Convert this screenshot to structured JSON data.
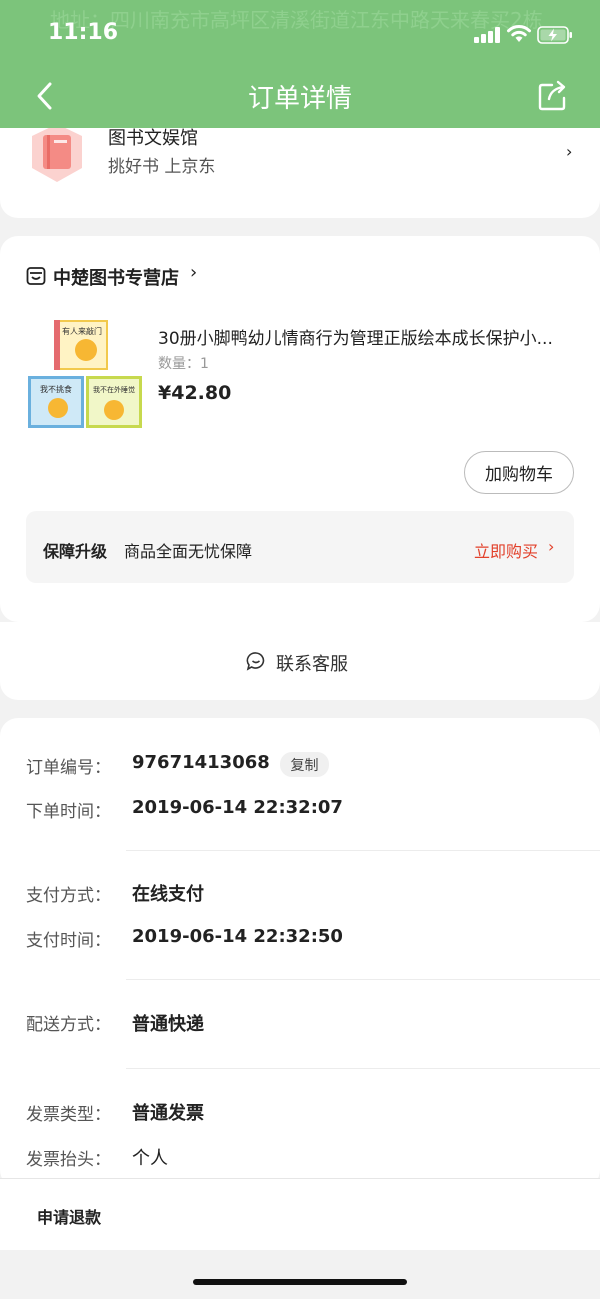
{
  "status_bar": {
    "time": "11:16",
    "ghost_text": "地址：四川南充市高坪区清溪街道江东中路天来春买2栋"
  },
  "header": {
    "title": "订单详情",
    "back_icon": "chevron-left-icon",
    "share_icon": "share-icon",
    "background": "#7cc47b"
  },
  "brand": {
    "name": "图书文娱馆",
    "slogan": "挑好书 上京东",
    "chevron": "›"
  },
  "store": {
    "name": "中楚图书专营店",
    "arrow": "›"
  },
  "product": {
    "title": "30册小脚鸭幼儿情商行为管理正版绘本成长保护小...",
    "quantity": "数量：1",
    "price": "¥42.80",
    "cover_texts": [
      "有人来敲门",
      "我不挑食",
      "我不在外睡觉"
    ]
  },
  "cart_button": "加购物车",
  "guarantee": {
    "label": "保障升级",
    "desc": "商品全面无忧保障",
    "buy": "立即购买",
    "chevron": "›",
    "accent": "#e2412b"
  },
  "customer_service": {
    "label": "联系客服"
  },
  "order": {
    "number_label": "订单编号：",
    "number": "97671413068",
    "copy": "复制",
    "order_time_label": "下单时间：",
    "order_time": "2019-06-14 22:32:07",
    "pay_method_label": "支付方式：",
    "pay_method": "在线支付",
    "pay_time_label": "支付时间：",
    "pay_time": "2019-06-14 22:32:50",
    "delivery_label": "配送方式：",
    "delivery": "普通快递",
    "invoice_type_label": "发票类型：",
    "invoice_type": "普通发票",
    "invoice_title_label": "发票抬头：",
    "invoice_title": "个人"
  },
  "bottom_bar": {
    "refund": "申请退款"
  }
}
